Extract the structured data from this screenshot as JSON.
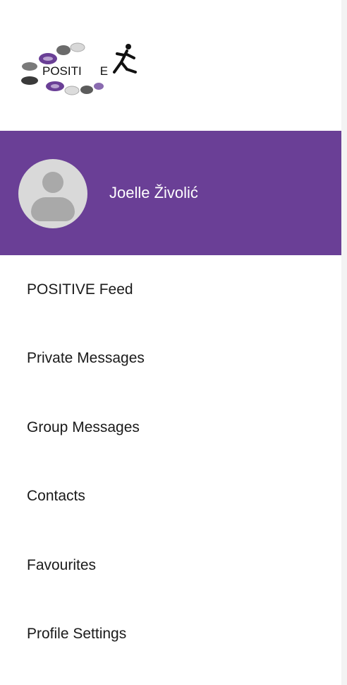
{
  "logo": {
    "text": "POSITI",
    "text_tail": "E",
    "accent_color": "#6a3f96"
  },
  "header": {
    "background_color": "#6a3f96",
    "avatar_icon": "default-user-avatar",
    "user_name": "Joelle Živolić"
  },
  "menu": {
    "items": [
      {
        "label": "POSITIVE Feed"
      },
      {
        "label": "Private Messages"
      },
      {
        "label": "Group Messages"
      },
      {
        "label": "Contacts"
      },
      {
        "label": "Favourites"
      },
      {
        "label": "Profile Settings"
      }
    ]
  }
}
